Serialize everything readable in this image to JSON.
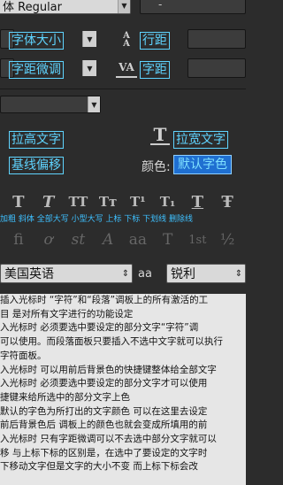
{
  "font_style": {
    "value": "常规体 Regular",
    "shown": "体 Regular"
  },
  "font_size_dropdown": {
    "value": "-"
  },
  "rows": {
    "font_size_label": "字体大小",
    "leading_label": "行距",
    "kerning_label": "字距微调",
    "tracking_label": "字距",
    "vertical_scale_label": "拉高文字",
    "horizontal_scale_label": "拉宽文字",
    "baseline_label": "基线偏移",
    "color_caption": "颜色:",
    "color_value": "默认字色"
  },
  "style_buttons": [
    {
      "glyph": "T",
      "name": "faux-bold"
    },
    {
      "glyph": "T",
      "name": "faux-italic"
    },
    {
      "glyph": "TT",
      "name": "all-caps"
    },
    {
      "glyph": "Tт",
      "name": "small-caps"
    },
    {
      "glyph": "T¹",
      "name": "superscript"
    },
    {
      "glyph": "T₁",
      "name": "subscript"
    },
    {
      "glyph": "T",
      "name": "underline"
    },
    {
      "glyph": "Ŧ",
      "name": "strikethrough"
    }
  ],
  "style_labels": "加粗 斜体 全部大写 小型大写 上标 下标 下划线 删除线",
  "ligature_buttons": [
    "fi",
    "ơ",
    "st",
    "A",
    "aa",
    "T",
    "1st",
    "½"
  ],
  "language": {
    "value": "美国英语"
  },
  "antialias": {
    "icon": "aa",
    "value": "锐利"
  },
  "notes": [
    "插入光标时 “字符”和“段落”调板上的所有激活的工",
    "目 是对所有文字进行的功能设定",
    "入光标时 必须要选中要设定的部分文字“字符”调",
    "可以使用。而段落面板只要插入不选中文字就可以执行",
    "字符面板。",
    "入光标时 可以用前后背景色的快捷键整体给全部文字",
    "入光标时 必须要选中要设定的部分文字才可以使用",
    "捷键来给所选中的部分文字上色",
    "默认的字色为所打出的文字颜色 可以在这里去设定",
    "前后背景色后 调板上的颜色也就会变成所填用的前",
    "入光标时 只有字距微调可以不去选中部分文字就可以",
    "移 与上标下标的区别是，在选中了要设定的文字时",
    "下移动文字但是文字的大小不变 而上标下标会改"
  ]
}
